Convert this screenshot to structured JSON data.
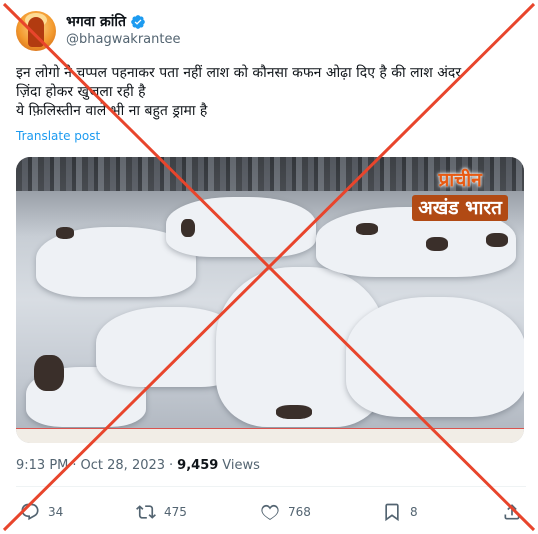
{
  "author": {
    "name": "भगवा क्रांति",
    "handle": "@bhagwakrantee",
    "verified": true
  },
  "tweet": {
    "text": "इन लोगो ने चप्पल पहनाकर पता नहीं लाश को कौनसा कफन ओढ़ा दिए है की लाश अंदर\nज़िंदा होकर खुजला रही है\nये फ़िलिस्तीन वाले भी ना बहुत ड्रामा है",
    "translate_label": "Translate post"
  },
  "media": {
    "badge_line1": "प्राचीन",
    "badge_line2": "अखंड भारत"
  },
  "meta": {
    "time": "9:13 PM",
    "separator": "·",
    "date": "Oct 28, 2023",
    "separator2": "·",
    "views_count": "9,459",
    "views_label": "Views"
  },
  "actions": {
    "replies": "34",
    "reposts": "475",
    "likes": "768",
    "bookmarks": "8"
  },
  "colors": {
    "accent": "#1d9bf0",
    "cross": "#e8452c",
    "secondary_text": "#536471"
  }
}
